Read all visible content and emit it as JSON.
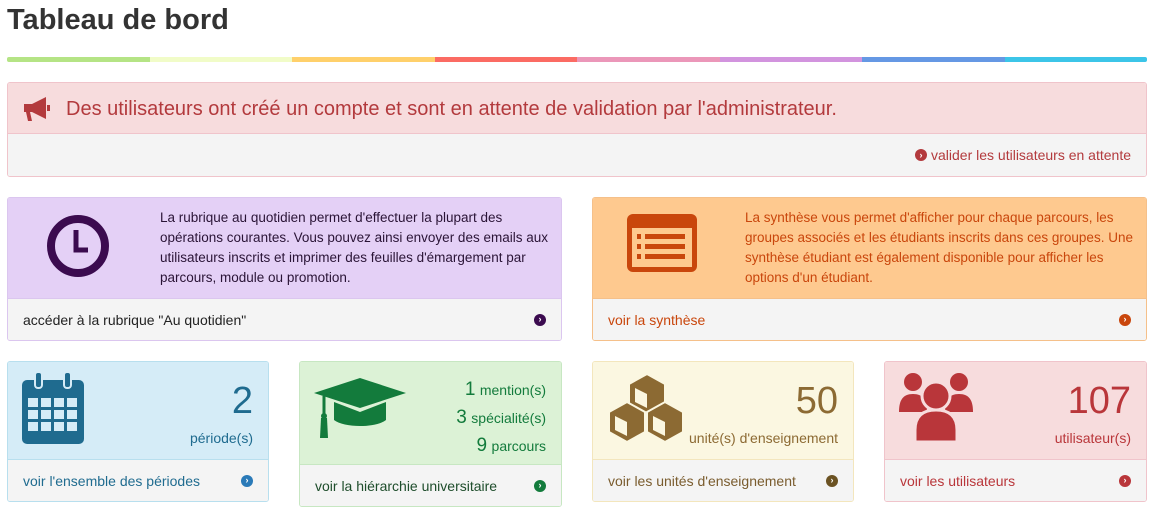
{
  "title": "Tableau de bord",
  "rainbow_colors": [
    "#b5e485",
    "#f1fcc8",
    "#ffd06b",
    "#fb6b63",
    "#eb97b9",
    "#d294de",
    "#6598e4",
    "#3cc5e8"
  ],
  "alert": {
    "message": "Des utilisateurs ont créé un compte et sont en attente de validation par l'administrateur.",
    "link": "valider les utilisateurs en attente",
    "icon": "bullhorn-icon"
  },
  "quotidien": {
    "description": "La rubrique au quotidien permet d'effectuer la plupart des opérations courantes. Vous pouvez ainsi envoyer des emails aux utilisateurs inscrits et imprimer des feuilles d'émargement par parcours, module ou promotion.",
    "link": "accéder à la rubrique \"Au quotidien\"",
    "icon": "clock-icon"
  },
  "synthese": {
    "description": "La synthèse vous permet d'afficher pour chaque parcours, les groupes associés et les étudiants inscrits dans ces groupes. Une synthèse étudiant est également disponible pour afficher les options d'un étudiant.",
    "link": "voir la synthèse",
    "icon": "list-icon"
  },
  "periodes": {
    "count": "2",
    "label": "période(s)",
    "link": "voir l'ensemble des périodes"
  },
  "hierarchie": {
    "mention_count": "1",
    "mention_label": "mention(s)",
    "specialite_count": "3",
    "specialite_label": "spécialité(s)",
    "parcours_count": "9",
    "parcours_label": "parcours",
    "link": "voir la hiérarchie universitaire"
  },
  "unites": {
    "count": "50",
    "label": "unité(s) d'enseignement",
    "link": "voir les unités d'enseignement"
  },
  "utilisateurs": {
    "count": "107",
    "label": "utilisateur(s)",
    "link": "voir les utilisateurs"
  }
}
